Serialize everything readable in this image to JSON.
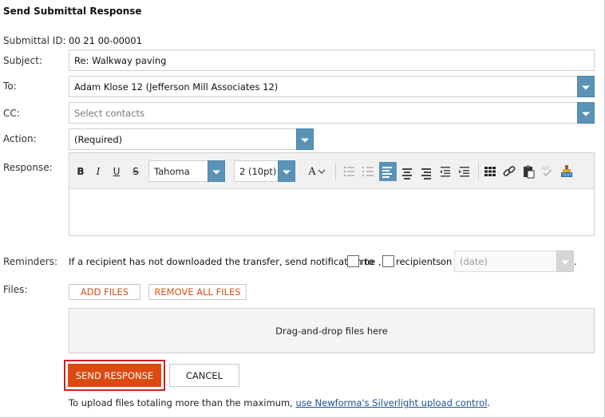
{
  "title": "Send Submittal Response",
  "labels": {
    "submittal_id": "Submittal ID:",
    "subject": "Subject:",
    "to": "To:",
    "cc": "CC:",
    "action": "Action:",
    "response": "Response:",
    "reminders": "Reminders:",
    "files": "Files:"
  },
  "values": {
    "submittal_id": "00 21 00-00001",
    "subject": "Re: Walkway paving",
    "to": "Adam Klose 12 (Jefferson Mill Associates 12)",
    "cc_placeholder": "Select contacts",
    "action": "(Required)"
  },
  "editor": {
    "bold": "B",
    "italic": "I",
    "underline": "U",
    "strike": "S",
    "font": "Tahoma",
    "size": "2 (10pt)",
    "text_color_glyph": "A"
  },
  "reminders": {
    "text_before": "If a recipient has not downloaded the transfer, send notification to",
    "me": "me ,",
    "recipients": "recipients",
    "on": "on",
    "date_placeholder": "(date)",
    "period": "."
  },
  "files": {
    "add": "ADD FILES",
    "remove_all": "REMOVE ALL FILES",
    "drop_text": "Drag-and-drop files here"
  },
  "buttons": {
    "send": "SEND RESPONSE",
    "cancel": "CANCEL"
  },
  "footer": {
    "text": "To upload files totaling more than the maximum,",
    "link": "use Newforma's Silverlight upload control",
    "end": "."
  },
  "colors": {
    "accent": "#5a93b7",
    "send": "#dc4a10",
    "highlight_border": "#d01f27",
    "file_btn_text": "#d4531a"
  }
}
